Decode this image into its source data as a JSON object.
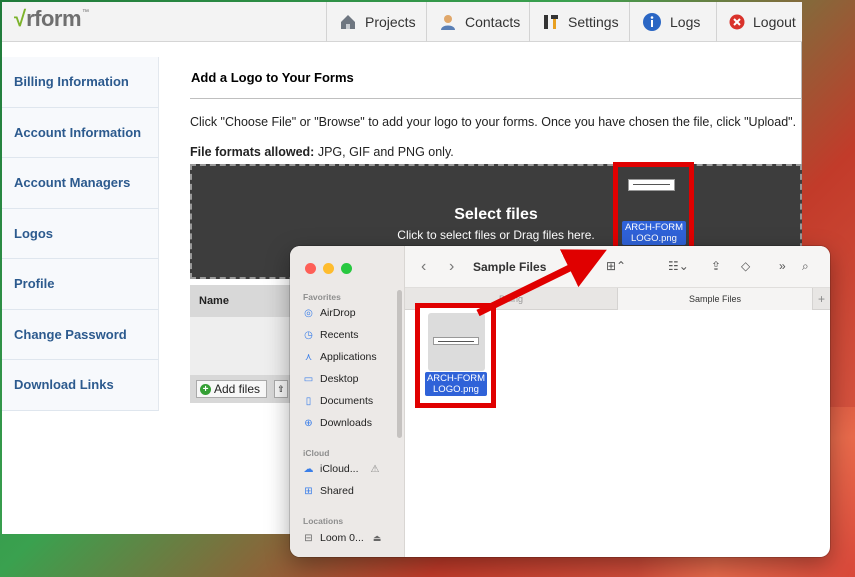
{
  "app": {
    "logo_check": "√",
    "logo_text": "rform",
    "logo_tm": "™"
  },
  "nav": [
    {
      "label": "Projects",
      "icon": "house-icon"
    },
    {
      "label": "Contacts",
      "icon": "person-icon"
    },
    {
      "label": "Settings",
      "icon": "tools-icon"
    },
    {
      "label": "Logs",
      "icon": "info-icon"
    },
    {
      "label": "Logout",
      "icon": "close-circle-icon"
    }
  ],
  "sidebar": {
    "items": [
      {
        "label": "Billing Information"
      },
      {
        "label": "Account Information"
      },
      {
        "label": "Account Managers"
      },
      {
        "label": "Logos"
      },
      {
        "label": "Profile"
      },
      {
        "label": "Change Password"
      },
      {
        "label": "Download Links"
      }
    ]
  },
  "main": {
    "title": "Add a Logo to Your Forms",
    "instructions": "Click \"Choose File\" or \"Browse\" to add your logo to your forms. Once you have chosen the file, click \"Upload\".",
    "formats_label": "File formats allowed:",
    "formats_value": " JPG, GIF and PNG only.",
    "dropzone_title": "Select files",
    "dropzone_sub": "Click to select files or Drag files here.",
    "table_header": "Name",
    "add_files_label": "Add files"
  },
  "dragged_file": {
    "name_line1": "ARCH-FORM",
    "name_line2": "LOGO.png"
  },
  "finder": {
    "title": "Sample Files",
    "tab1": "Billing",
    "tab2": "Sample Files",
    "favorites_label": "Favorites",
    "favorites": [
      {
        "label": "AirDrop",
        "icon": "airdrop-icon"
      },
      {
        "label": "Recents",
        "icon": "clock-icon"
      },
      {
        "label": "Applications",
        "icon": "applications-icon"
      },
      {
        "label": "Desktop",
        "icon": "desktop-icon"
      },
      {
        "label": "Documents",
        "icon": "document-icon"
      },
      {
        "label": "Downloads",
        "icon": "download-icon"
      }
    ],
    "icloud_label": "iCloud",
    "icloud": [
      {
        "label": "iCloud...",
        "icon": "cloud-icon"
      },
      {
        "label": "Shared",
        "icon": "shared-folder-icon"
      }
    ],
    "locations_label": "Locations",
    "locations": [
      {
        "label": "Loom 0...",
        "icon": "disk-icon"
      }
    ],
    "file": {
      "name_line1": "ARCH-FORM",
      "name_line2": "LOGO.png"
    }
  },
  "colors": {
    "highlight_red": "#e00000",
    "selection_blue": "#2f62d8",
    "link_blue": "#2c5a8e",
    "dropzone_bg": "#3d3d3d"
  }
}
